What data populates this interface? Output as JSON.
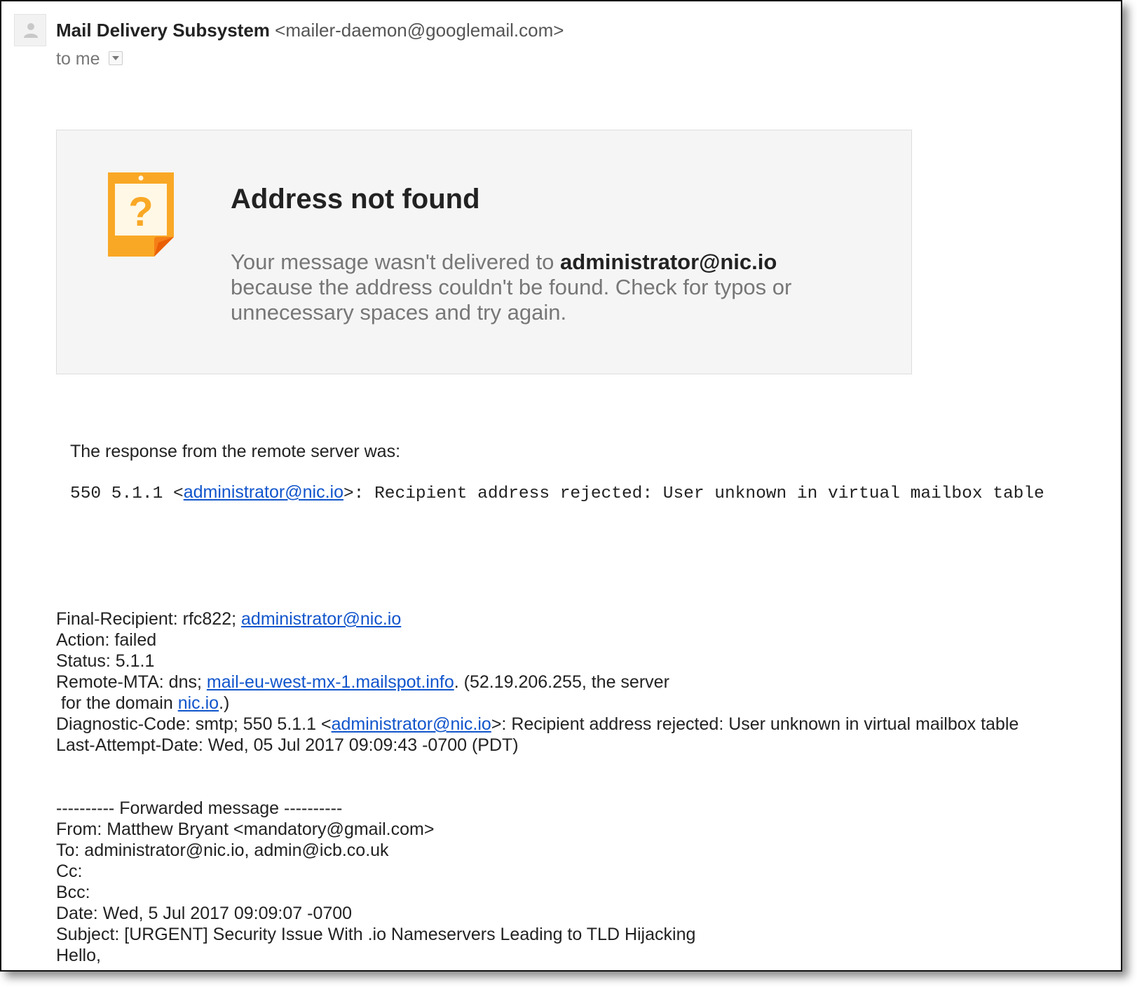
{
  "header": {
    "sender_name": "Mail Delivery Subsystem",
    "sender_email": "<mailer-daemon@googlemail.com>",
    "recipient_text": "to me"
  },
  "notice": {
    "title": "Address not found",
    "body_prefix": "Your message wasn't delivered to ",
    "body_address": "administrator@nic.io",
    "body_suffix": "because the address couldn't be found. Check for typos or unnecessary spaces and try again.",
    "accent_color": "#F9A825"
  },
  "response": {
    "label": "The response from the remote server was:",
    "code_prefix": "550 5.1.1 <",
    "code_link": "administrator@nic.io",
    "code_suffix": ">: Recipient address rejected: User unknown in virtual mailbox table"
  },
  "dsn": {
    "final_recipient_prefix": "Final-Recipient: rfc822; ",
    "final_recipient_link": "administrator@nic.io",
    "action": "Action: failed",
    "status": "Status: 5.1.1",
    "remote_mta_prefix": "Remote-MTA: dns; ",
    "remote_mta_link": "mail-eu-west-mx-1.mailspot.info",
    "remote_mta_suffix": ". (52.19.206.255, the server",
    "domain_prefix": " for the domain ",
    "domain_link": "nic.io",
    "domain_suffix": ".)",
    "diagnostic_prefix": "Diagnostic-Code: smtp; 550 5.1.1 <",
    "diagnostic_link": "administrator@nic.io",
    "diagnostic_suffix": ">: Recipient address rejected: User unknown in virtual mailbox table",
    "last_attempt": "Last-Attempt-Date: Wed, 05 Jul 2017 09:09:43 -0700 (PDT)"
  },
  "forwarded": {
    "separator": "---------- Forwarded message ----------",
    "from": "From: Matthew Bryant <mandatory@gmail.com>",
    "to": "To: administrator@nic.io, admin@icb.co.uk",
    "cc": "Cc:",
    "bcc": "Bcc:",
    "date": "Date: Wed, 5 Jul 2017 09:09:07 -0700",
    "subject": "Subject: [URGENT] Security Issue With .io Nameservers Leading to TLD Hijacking",
    "greeting": "Hello,"
  },
  "colors": {
    "link": "#1155cc",
    "notice_bg": "#f5f5f5",
    "icon_orange": "#F9A825"
  }
}
